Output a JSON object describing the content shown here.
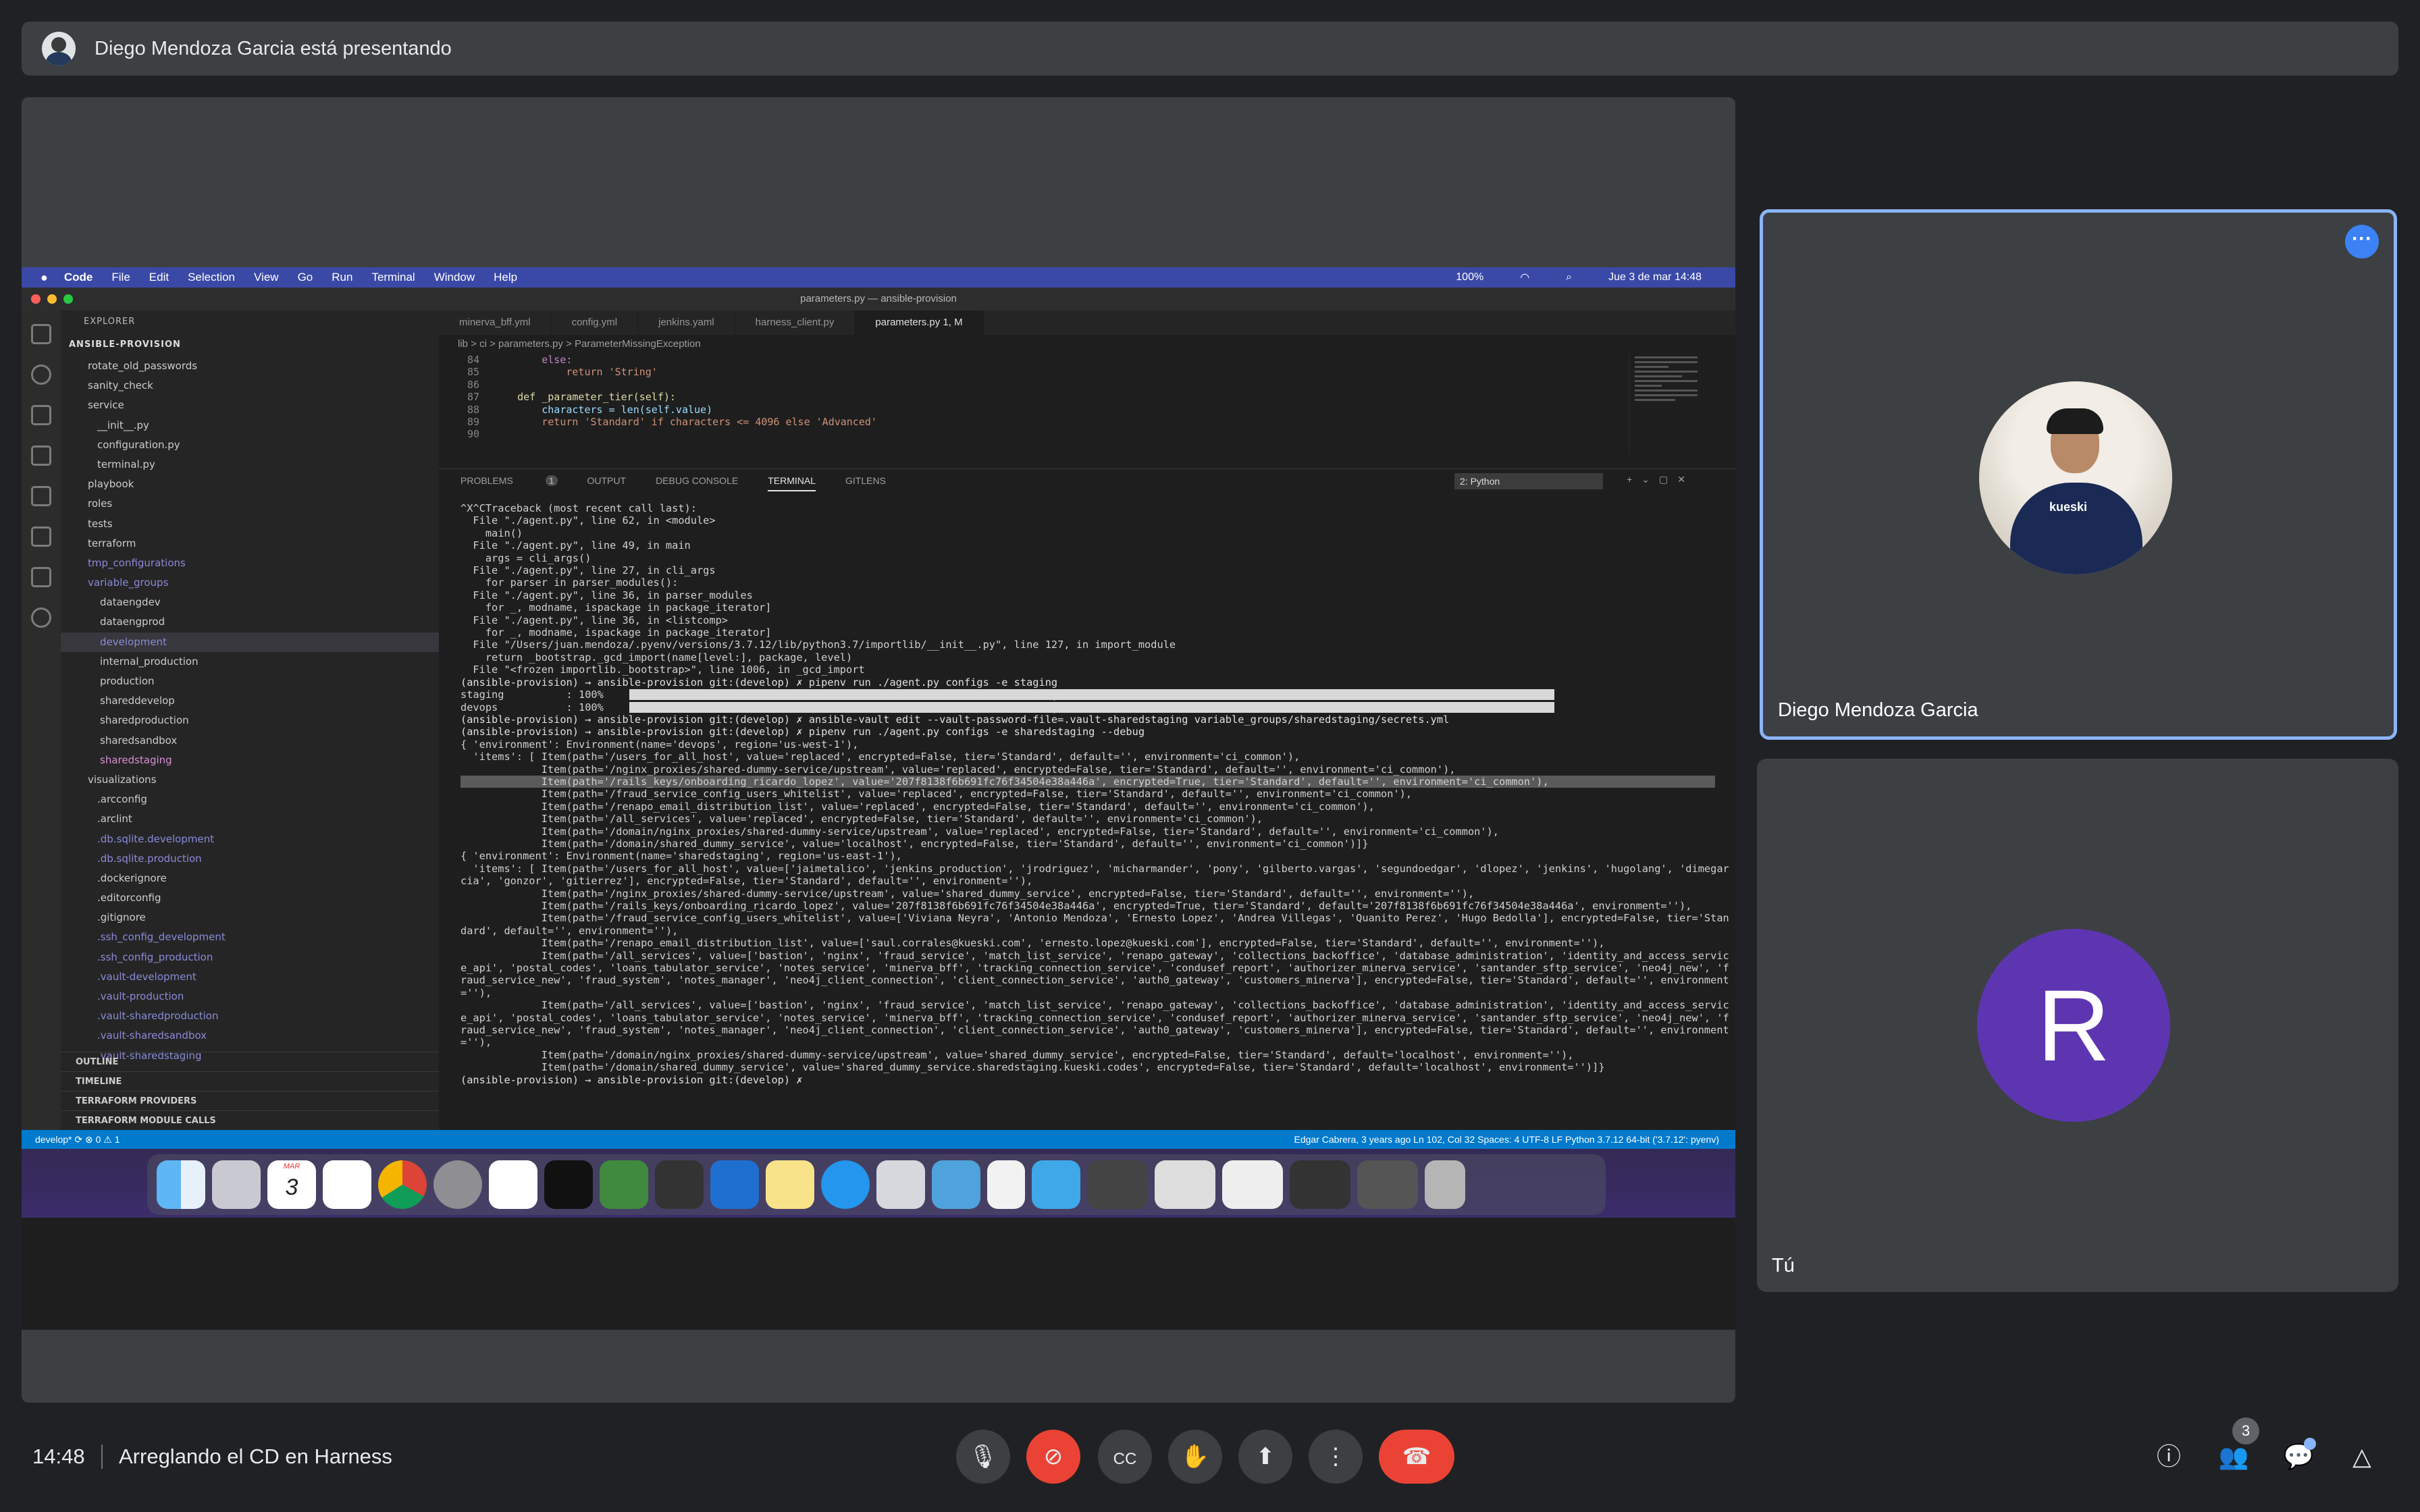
{
  "banner": {
    "text": "Diego Mendoza Garcia está presentando"
  },
  "shared_screen": {
    "mac_menu": [
      "Code",
      "File",
      "Edit",
      "Selection",
      "View",
      "Go",
      "Run",
      "Terminal",
      "Window",
      "Help"
    ],
    "mac_status": {
      "battery": "100%",
      "datetime": "Jue 3 de mar  14:48"
    },
    "window_title": "parameters.py — ansible-provision",
    "explorer": {
      "header": "EXPLORER",
      "root": "ANSIBLE-PROVISION",
      "items": [
        "rotate_old_passwords",
        "sanity_check",
        "service",
        "__init__.py",
        "configuration.py",
        "terminal.py",
        "playbook",
        "roles",
        "tests",
        "terraform",
        "tmp_configurations",
        "variable_groups",
        "dataengdev",
        "dataengprod",
        "development",
        "internal_production",
        "production",
        "shareddevelop",
        "sharedproduction",
        "sharedsandbox",
        "sharedstaging",
        "visualizations",
        ".arcconfig",
        ".arclint",
        ".db.sqlite.development",
        ".db.sqlite.production",
        ".dockerignore",
        ".editorconfig",
        ".gitignore",
        ".ssh_config_development",
        ".ssh_config_production",
        ".vault-development",
        ".vault-production",
        ".vault-sharedproduction",
        ".vault-sharedsandbox",
        ".vault-sharedstaging"
      ],
      "sections": [
        "OUTLINE",
        "TIMELINE",
        "TERRAFORM PROVIDERS",
        "TERRAFORM MODULE CALLS"
      ]
    },
    "tabs": [
      "minerva_bff.yml",
      "config.yml",
      "jenkins.yaml",
      "harness_client.py",
      "parameters.py 1, M"
    ],
    "breadcrumb": "lib > ci > parameters.py > ParameterMissingException",
    "code": [
      {
        "ln": "84",
        "text": "        else:"
      },
      {
        "ln": "85",
        "text": "            return 'String'"
      },
      {
        "ln": "86",
        "text": ""
      },
      {
        "ln": "87",
        "text": "    def _parameter_tier(self):"
      },
      {
        "ln": "88",
        "text": "        characters = len(self.value)"
      },
      {
        "ln": "89",
        "text": "        return 'Standard' if characters <= 4096 else 'Advanced'"
      },
      {
        "ln": "90",
        "text": ""
      }
    ],
    "panel_tabs": [
      "PROBLEMS",
      "OUTPUT",
      "DEBUG CONSOLE",
      "TERMINAL",
      "GITLENS"
    ],
    "problems_count": "1",
    "terminal_select": "2: Python",
    "terminal": [
      "^X^CTraceback (most recent call last):",
      "  File \"./agent.py\", line 62, in <module>",
      "    main()",
      "  File \"./agent.py\", line 49, in main",
      "    args = cli_args()",
      "  File \"./agent.py\", line 27, in cli_args",
      "    for parser in parser_modules():",
      "  File \"./agent.py\", line 36, in parser_modules",
      "    for _, modname, ispackage in package_iterator]",
      "  File \"./agent.py\", line 36, in <listcomp>",
      "    for _, modname, ispackage in package_iterator]",
      "  File \"/Users/juan.mendoza/.pyenv/versions/3.7.12/lib/python3.7/importlib/__init__.py\", line 127, in import_module",
      "    return _bootstrap._gcd_import(name[level:], package, level)",
      "  File \"<frozen importlib._bootstrap>\", line 1006, in _gcd_import",
      "(ansible-provision) → ansible-provision git:(develop) ✗ pipenv run ./agent.py configs -e staging",
      "",
      "staging          : 100%                                                                        | 3/3 [00:00<00:00,  6.98it/s]",
      "devops           : 100%                                                                        | 3/3 [00:01<00:00,  2.12it/s]",
      "(ansible-provision) → ansible-provision git:(develop) ✗ ansible-vault edit --vault-password-file=.vault-sharedstaging variable_groups/sharedstaging/secrets.yml",
      "(ansible-provision) → ansible-provision git:(develop) ✗ pipenv run ./agent.py configs -e sharedstaging --debug",
      "",
      "{ 'environment': Environment(name='devops', region='us-west-1'),",
      "  'items': [ Item(path='/users_for_all_host', value='replaced', encrypted=False, tier='Standard', default='', environment='ci_common'),",
      "             Item(path='/nginx_proxies/shared-dummy-service/upstream', value='replaced', encrypted=False, tier='Standard', default='', environment='ci_common'),",
      "             Item(path='/rails_keys/onboarding_ricardo_lopez', value='207f8138f6b691fc76f34504e38a446a', encrypted=True, tier='Standard', default='', environment='ci_common'),",
      "             Item(path='/fraud_service_config_users_whitelist', value='replaced', encrypted=False, tier='Standard', default='', environment='ci_common'),",
      "             Item(path='/renapo_email_distribution_list', value='replaced', encrypted=False, tier='Standard', default='', environment='ci_common'),",
      "             Item(path='/all_services', value='replaced', encrypted=False, tier='Standard', default='', environment='ci_common'),",
      "             Item(path='/domain/nginx_proxies/shared-dummy-service/upstream', value='replaced', encrypted=False, tier='Standard', default='', environment='ci_common'),",
      "             Item(path='/domain/shared_dummy_service', value='localhost', encrypted=False, tier='Standard', default='', environment='ci_common')]}",
      "{ 'environment': Environment(name='sharedstaging', region='us-east-1'),",
      "  'items': [ Item(path='/users_for_all_host', value=['jaimetalico', 'jenkins_production', 'jrodriguez', 'micharmander', 'pony', 'gilberto.vargas', 'segundoedgar', 'dlopez', 'jenkins', 'hugolang', 'dimegar",
      "cia', 'gonzor', 'gitierrez'], encrypted=False, tier='Standard', default='', environment=''),",
      "             Item(path='/nginx_proxies/shared-dummy-service/upstream', value='shared_dummy_service', encrypted=False, tier='Standard', default='', environment=''),",
      "             Item(path='/rails_keys/onboarding_ricardo_lopez', value='207f8138f6b691fc76f34504e38a446a', encrypted=True, tier='Standard', default='207f8138f6b691fc76f34504e38a446a', environment=''),",
      "             Item(path='/fraud_service_config_users_whitelist', value=['Viviana Neyra', 'Antonio Mendoza', 'Ernesto Lopez', 'Andrea Villegas', 'Quanito Perez', 'Hugo Bedolla'], encrypted=False, tier='Stan",
      "dard', default='', environment=''),",
      "             Item(path='/renapo_email_distribution_list', value=['saul.corrales@kueski.com', 'ernesto.lopez@kueski.com'], encrypted=False, tier='Standard', default='', environment=''),",
      "             Item(path='/all_services', value=['bastion', 'nginx', 'fraud_service', 'match_list_service', 'renapo_gateway', 'collections_backoffice', 'database_administration', 'identity_and_access_servic",
      "e_api', 'postal_codes', 'loans_tabulator_service', 'notes_service', 'minerva_bff', 'tracking_connection_service', 'condusef_report', 'authorizer_minerva_service', 'santander_sftp_service', 'neo4j_new', 'f",
      "raud_service_new', 'fraud_system', 'notes_manager', 'neo4j_client_connection', 'client_connection_service', 'auth0_gateway', 'customers_minerva'], encrypted=False, tier='Standard', default='', environment",
      "=''),",
      "             Item(path='/all_services', value=['bastion', 'nginx', 'fraud_service', 'match_list_service', 'renapo_gateway', 'collections_backoffice', 'database_administration', 'identity_and_access_servic",
      "e_api', 'postal_codes', 'loans_tabulator_service', 'notes_service', 'minerva_bff', 'tracking_connection_service', 'condusef_report', 'authorizer_minerva_service', 'santander_sftp_service', 'neo4j_new', 'f",
      "raud_service_new', 'fraud_system', 'notes_manager', 'neo4j_client_connection', 'client_connection_service', 'auth0_gateway', 'customers_minerva'], encrypted=False, tier='Standard', default='', environment",
      "=''),",
      "             Item(path='/domain/nginx_proxies/shared-dummy-service/upstream', value='shared_dummy_service', encrypted=False, tier='Standard', default='localhost', environment=''),",
      "             Item(path='/domain/shared_dummy_service', value='shared_dummy_service.sharedstaging.kueski.codes', encrypted=False, tier='Standard', default='localhost', environment='')]}",
      "(ansible-provision) → ansible-provision git:(develop) ✗ "
    ],
    "status_left": "develop*   ⟳   ⊗ 0 ⚠ 1",
    "status_right": "Edgar Cabrera, 3 years ago    Ln 102, Col 32    Spaces: 4    UTF-8    LF    Python    3.7.12 64-bit ('3.7.12': pyenv)",
    "dock_calendar": {
      "month": "MAR",
      "day": "3"
    }
  },
  "participants": [
    {
      "name": "Diego Mendoza Garcia"
    },
    {
      "name": "Tú",
      "initial": "R"
    }
  ],
  "bottom": {
    "time": "14:48",
    "meeting_title": "Arreglando el CD en Harness",
    "people_count": "3"
  },
  "colors": {
    "accent": "#8ab4f8",
    "hangup": "#ea4335",
    "avatar_bg": "#5e35b1",
    "vscode_status": "#007acc"
  }
}
